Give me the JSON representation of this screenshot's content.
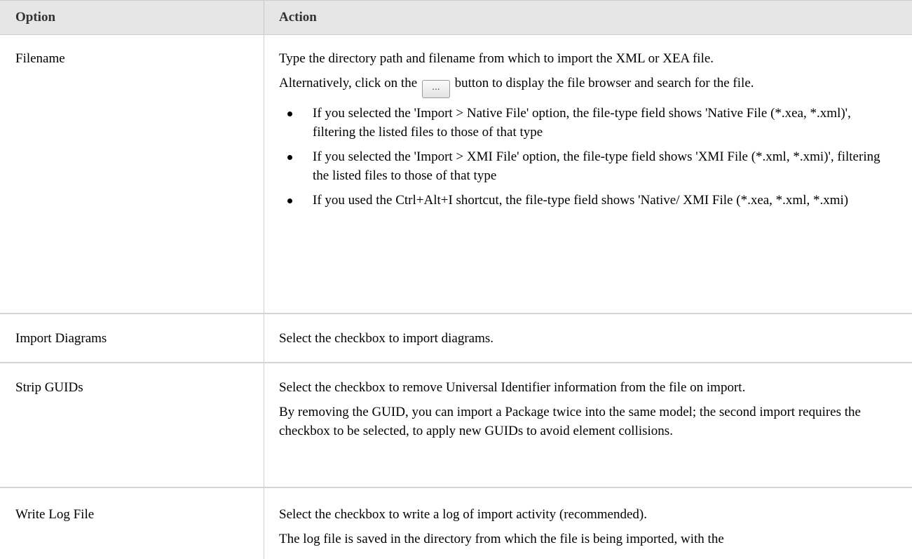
{
  "header": {
    "option": "Option",
    "action": "Action"
  },
  "rows": [
    {
      "option": "Filename",
      "p1": "Type the directory path and filename from which to import the XML or XEA file.",
      "p2_before": "Alternatively, click on the",
      "p2_button": "...",
      "p2_after": "button to display the file browser and search for the file.",
      "bullets": [
        "If you selected the 'Import > Native File' option, the file-type field shows 'Native File (*.xea, *.xml)', filtering the listed files to those of that type",
        "If you selected the 'Import > XMI File' option, the file-type field shows 'XMI File (*.xml, *.xmi)', filtering the listed files to those of that type",
        "If you used the Ctrl+Alt+I shortcut, the file-type field shows 'Native/ XMI File (*.xea, *.xml, *.xmi)"
      ]
    },
    {
      "option": "Import Diagrams",
      "p1": "Select the checkbox to import diagrams."
    },
    {
      "option": "Strip GUIDs",
      "p1": "Select the checkbox to remove Universal Identifier information from the file on import.",
      "p2": "By removing the GUID, you can import a Package twice into the same model; the second import requires the checkbox to be selected, to apply new GUIDs to avoid element collisions."
    },
    {
      "option": "Write Log File",
      "p1": "Select the checkbox to write a log of import activity (recommended).",
      "p2": "The log file is saved in the directory from which the file is being imported, with the"
    }
  ]
}
